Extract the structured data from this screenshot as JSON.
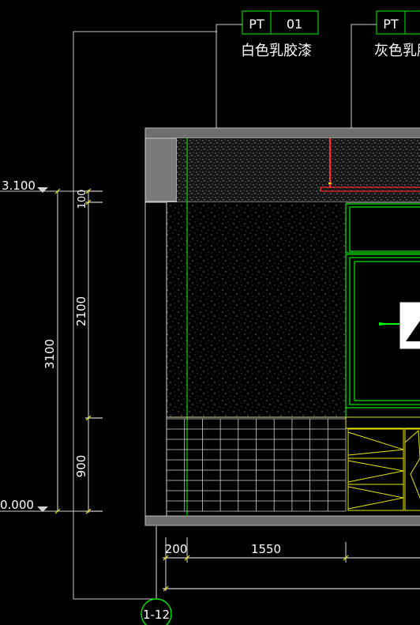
{
  "tags": [
    {
      "code": "PT",
      "num": "01",
      "label": "白色乳胶漆"
    },
    {
      "code": "PT",
      "num": "",
      "label": "灰色乳胶"
    }
  ],
  "levels": {
    "top": "3.100",
    "bottom": "0.000"
  },
  "dimensions": {
    "vertical_total": "3100",
    "vertical_parts": [
      "100",
      "2100",
      "900"
    ],
    "horizontal_parts": [
      "200",
      "1550"
    ]
  },
  "grid_bubble": "1-12",
  "colors": {
    "tag_border": "#00cc00",
    "wall_line": "#00ff00",
    "dim_line": "#e8e800",
    "pipe": "#ff2a2a",
    "wall_fill": "#7a7a7a",
    "text": "#ffffff"
  }
}
